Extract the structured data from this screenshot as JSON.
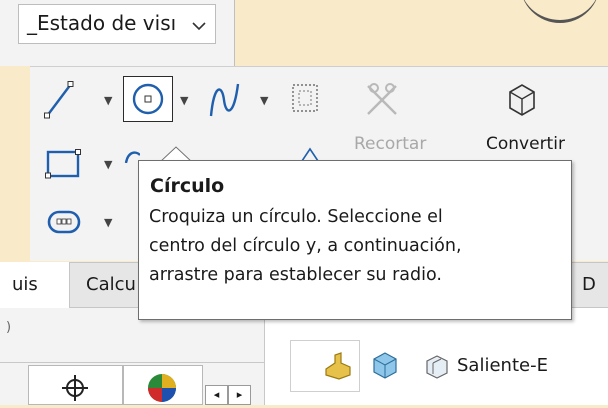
{
  "toolbar": {
    "display_state_label": "_Estado de visı",
    "trim_label": "Recortar",
    "convert_label": "Convertir"
  },
  "tabs": {
    "sketch_partial": "uis",
    "calc_partial": "Calcu",
    "hidden_partial": "D"
  },
  "tooltip": {
    "title": "Círculo",
    "lines": [
      "Croquiza un círculo. Seleccione el",
      "centro del círculo y, a continuación,",
      "arrastre para establecer su radio."
    ]
  },
  "breadcrumb": {
    "last_label": "Saliente-E"
  },
  "panel": {
    "small_mark": ")"
  },
  "icons": {
    "line": "line-icon",
    "circle": "circle-icon",
    "spline": "spline-icon",
    "rectangle": "rectangle-icon",
    "slot": "slot-icon",
    "trim": "trim-entities-icon",
    "convert": "convert-entities-icon"
  }
}
